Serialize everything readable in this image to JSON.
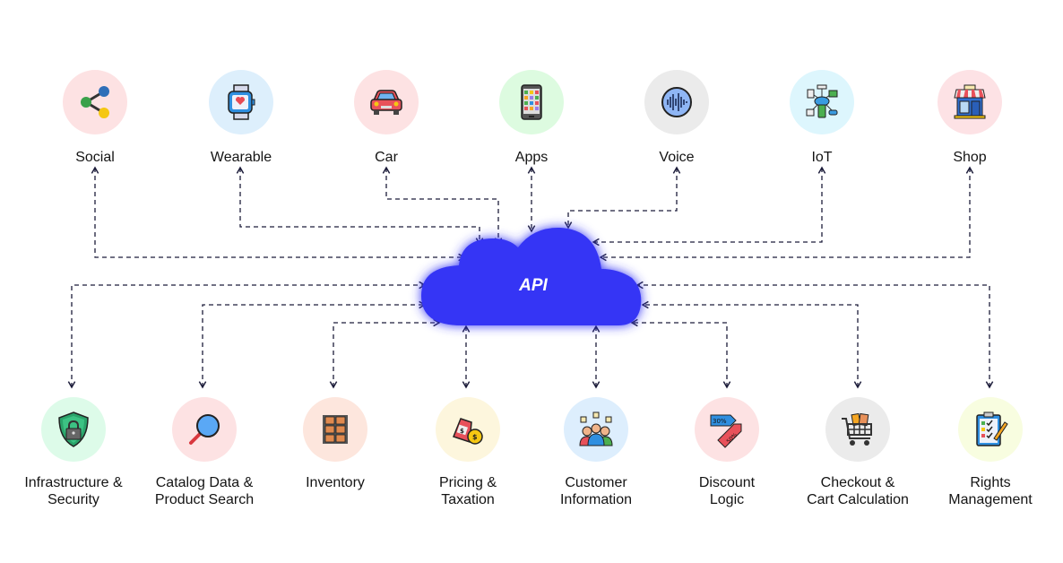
{
  "hub": {
    "label": "API",
    "color": "#3535f5"
  },
  "connector_color": "#1c1c3a",
  "top_nodes": [
    {
      "label": "Social",
      "icon": "share-icon",
      "bg": "#fde2e3"
    },
    {
      "label": "Wearable",
      "icon": "smartwatch-icon",
      "bg": "#ddeffc"
    },
    {
      "label": "Car",
      "icon": "car-icon",
      "bg": "#fde2e3"
    },
    {
      "label": "Apps",
      "icon": "smartphone-apps-icon",
      "bg": "#ddfbe0"
    },
    {
      "label": "Voice",
      "icon": "voice-wave-icon",
      "bg": "#ebebeb"
    },
    {
      "label": "IoT",
      "icon": "iot-network-icon",
      "bg": "#ddf6fd"
    },
    {
      "label": "Shop",
      "icon": "storefront-icon",
      "bg": "#fde2e5"
    }
  ],
  "bottom_nodes": [
    {
      "label": "Infrastructure &\nSecurity",
      "icon": "shield-lock-icon",
      "bg": "#ddfbe9"
    },
    {
      "label": "Catalog Data &\nProduct Search",
      "icon": "magnifier-icon",
      "bg": "#fde2e3"
    },
    {
      "label": "Inventory",
      "icon": "warehouse-shelf-icon",
      "bg": "#fde6dd"
    },
    {
      "label": "Pricing &\nTaxation",
      "icon": "price-tag-coin-icon",
      "bg": "#fdf6dd"
    },
    {
      "label": "Customer\nInformation",
      "icon": "customers-group-icon",
      "bg": "#ddeefd"
    },
    {
      "label": "Discount\nLogic",
      "icon": "discount-tag-icon",
      "bg": "#fde2e3"
    },
    {
      "label": "Checkout &\nCart Calculation",
      "icon": "shopping-cart-icon",
      "bg": "#ebebeb"
    },
    {
      "label": "Rights\nManagement",
      "icon": "checklist-clipboard-icon",
      "bg": "#f8fde0"
    }
  ],
  "edges": [
    {
      "from": "Social",
      "to": "API",
      "bidirectional": true
    },
    {
      "from": "Wearable",
      "to": "API",
      "bidirectional": true
    },
    {
      "from": "Car",
      "to": "API",
      "bidirectional": true
    },
    {
      "from": "Apps",
      "to": "API",
      "bidirectional": true
    },
    {
      "from": "Voice",
      "to": "API",
      "bidirectional": true
    },
    {
      "from": "IoT",
      "to": "API",
      "bidirectional": true
    },
    {
      "from": "Shop",
      "to": "API",
      "bidirectional": true
    },
    {
      "from": "API",
      "to": "Infrastructure & Security",
      "bidirectional": true
    },
    {
      "from": "API",
      "to": "Catalog Data & Product Search",
      "bidirectional": true
    },
    {
      "from": "API",
      "to": "Inventory",
      "bidirectional": true
    },
    {
      "from": "API",
      "to": "Pricing & Taxation",
      "bidirectional": true
    },
    {
      "from": "API",
      "to": "Customer Information",
      "bidirectional": true
    },
    {
      "from": "API",
      "to": "Discount Logic",
      "bidirectional": true
    },
    {
      "from": "API",
      "to": "Checkout & Cart Calculation",
      "bidirectional": true
    },
    {
      "from": "API",
      "to": "Rights Management",
      "bidirectional": true
    }
  ]
}
